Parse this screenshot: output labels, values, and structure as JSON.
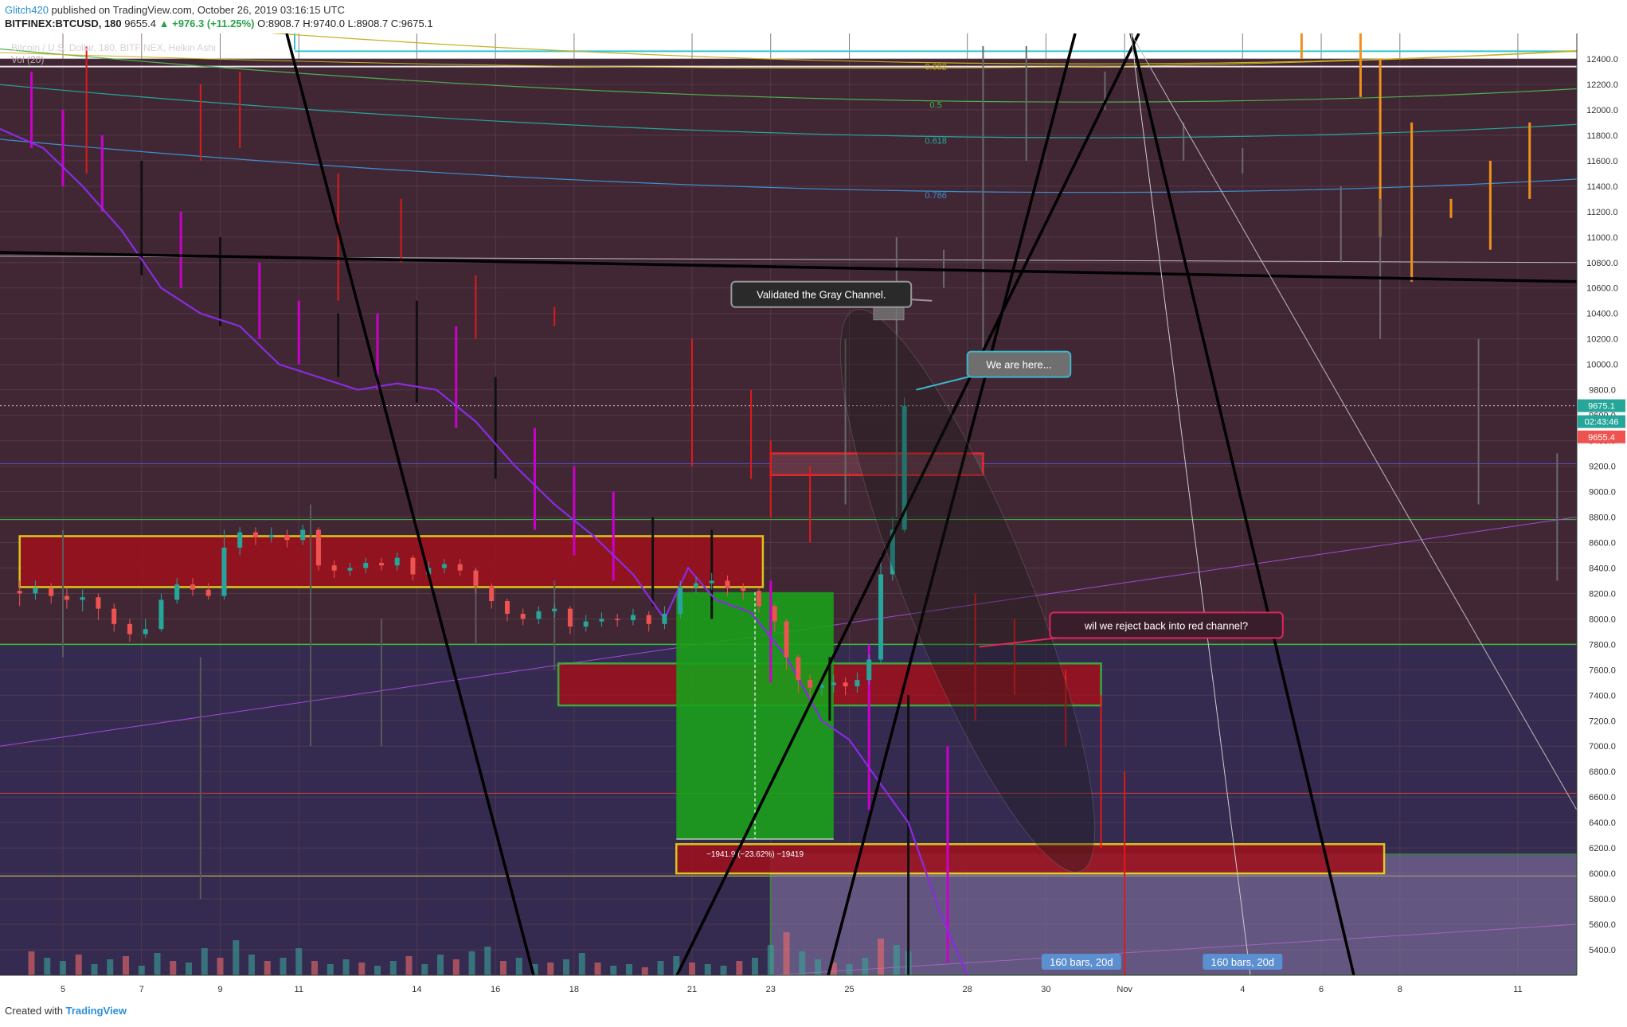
{
  "header": {
    "user": "Glitch420",
    "published_text": "published on TradingView.com, October 26, 2019 03:16:15 UTC",
    "symbol": "BITFINEX:BTCUSD, 180",
    "last": "9655.4",
    "change": "▲ +976.3 (+11.25%)",
    "ohlc": "O:8908.7 H:9740.0 L:8908.7 C:9675.1"
  },
  "legend": {
    "title": "Bitcoin / U.S. Dollar, 180, BITFINEX, Heikin Ashi",
    "volume": "Vol (20)"
  },
  "footer": {
    "created_with": "Created with",
    "brand": "TradingView"
  },
  "colors": {
    "background": "#412734",
    "panel_lower": "#352a4f",
    "bull": "#26a69a",
    "bear": "#ef5350",
    "accent_green": "#1aa01a",
    "zone_red": "#9a1723",
    "zone_border_yellow": "#f5e11a"
  },
  "chart_data": {
    "type": "candlestick",
    "ylim": [
      5200,
      12600
    ],
    "y_ticks": [
      5400,
      5600,
      5800,
      6000,
      6200,
      6400,
      6600,
      6800,
      7000,
      7200,
      7400,
      7600,
      7800,
      8000,
      8200,
      8400,
      8600,
      8800,
      9000,
      9200,
      9400,
      9600,
      9800,
      10000,
      10200,
      10400,
      10600,
      10800,
      11000,
      11200,
      11400,
      11600,
      11800,
      12000,
      12200,
      12400
    ],
    "x_ticks": [
      {
        "label": "5",
        "day": 5
      },
      {
        "label": "7",
        "day": 7
      },
      {
        "label": "9",
        "day": 9
      },
      {
        "label": "11",
        "day": 11
      },
      {
        "label": "14",
        "day": 14
      },
      {
        "label": "16",
        "day": 16
      },
      {
        "label": "18",
        "day": 18
      },
      {
        "label": "21",
        "day": 21
      },
      {
        "label": "23",
        "day": 23
      },
      {
        "label": "25",
        "day": 25
      },
      {
        "label": "28",
        "day": 28
      },
      {
        "label": "30",
        "day": 30
      },
      {
        "label": "Nov",
        "day": 32
      },
      {
        "label": "4",
        "day": 35
      },
      {
        "label": "6",
        "day": 37
      },
      {
        "label": "8",
        "day": 39
      },
      {
        "label": "11",
        "day": 42
      }
    ],
    "price_badges": [
      {
        "text": "9675.1",
        "price": 9675.1,
        "color": "#26a69a"
      },
      {
        "text": "02:43:46",
        "price": 9550,
        "color": "#26a69a"
      },
      {
        "text": "9655.4",
        "price": 9430,
        "color": "#ef5350"
      }
    ],
    "fib_levels": [
      {
        "label": "0.382",
        "price": 12340,
        "color": "#c8b020"
      },
      {
        "label": "0.5",
        "price": 12040,
        "color": "#4caf50"
      },
      {
        "label": "0.618",
        "price": 11760,
        "color": "#26a69a"
      },
      {
        "label": "0.786",
        "price": 11330,
        "color": "#3d8fd0"
      }
    ],
    "candles_fine": [
      {
        "day": 3.9,
        "o": 8220,
        "c": 8200,
        "h": 8300,
        "l": 8100
      },
      {
        "day": 4.3,
        "o": 8200,
        "c": 8240,
        "h": 8300,
        "l": 8150
      },
      {
        "day": 4.7,
        "o": 8240,
        "c": 8180,
        "h": 8280,
        "l": 8120
      },
      {
        "day": 5.1,
        "o": 8180,
        "c": 8150,
        "h": 8250,
        "l": 8080
      },
      {
        "day": 5.5,
        "o": 8150,
        "c": 8170,
        "h": 8230,
        "l": 8060
      },
      {
        "day": 5.9,
        "o": 8170,
        "c": 8080,
        "h": 8200,
        "l": 7990
      },
      {
        "day": 6.3,
        "o": 8080,
        "c": 7960,
        "h": 8120,
        "l": 7900
      },
      {
        "day": 6.7,
        "o": 7960,
        "c": 7880,
        "h": 8000,
        "l": 7820
      },
      {
        "day": 7.1,
        "o": 7880,
        "c": 7920,
        "h": 8000,
        "l": 7850
      },
      {
        "day": 7.5,
        "o": 7920,
        "c": 8150,
        "h": 8200,
        "l": 7900
      },
      {
        "day": 7.9,
        "o": 8150,
        "c": 8270,
        "h": 8320,
        "l": 8120
      },
      {
        "day": 8.3,
        "o": 8270,
        "c": 8230,
        "h": 8320,
        "l": 8180
      },
      {
        "day": 8.7,
        "o": 8230,
        "c": 8180,
        "h": 8280,
        "l": 8150
      },
      {
        "day": 9.1,
        "o": 8180,
        "c": 8560,
        "h": 8700,
        "l": 8150
      },
      {
        "day": 9.5,
        "o": 8560,
        "c": 8680,
        "h": 8720,
        "l": 8500
      },
      {
        "day": 9.9,
        "o": 8680,
        "c": 8640,
        "h": 8720,
        "l": 8580
      },
      {
        "day": 10.3,
        "o": 8640,
        "c": 8660,
        "h": 8720,
        "l": 8600
      },
      {
        "day": 10.7,
        "o": 8660,
        "c": 8620,
        "h": 8700,
        "l": 8560
      },
      {
        "day": 11.1,
        "o": 8620,
        "c": 8700,
        "h": 8740,
        "l": 8580
      },
      {
        "day": 11.5,
        "o": 8700,
        "c": 8420,
        "h": 8720,
        "l": 8380
      },
      {
        "day": 11.9,
        "o": 8420,
        "c": 8380,
        "h": 8460,
        "l": 8320
      },
      {
        "day": 12.3,
        "o": 8380,
        "c": 8400,
        "h": 8440,
        "l": 8340
      },
      {
        "day": 12.7,
        "o": 8400,
        "c": 8440,
        "h": 8480,
        "l": 8360
      },
      {
        "day": 13.1,
        "o": 8440,
        "c": 8420,
        "h": 8480,
        "l": 8380
      },
      {
        "day": 13.5,
        "o": 8420,
        "c": 8480,
        "h": 8520,
        "l": 8380
      },
      {
        "day": 13.9,
        "o": 8480,
        "c": 8350,
        "h": 8500,
        "l": 8300
      },
      {
        "day": 14.3,
        "o": 8350,
        "c": 8400,
        "h": 8450,
        "l": 8310
      },
      {
        "day": 14.7,
        "o": 8400,
        "c": 8430,
        "h": 8470,
        "l": 8360
      },
      {
        "day": 15.1,
        "o": 8430,
        "c": 8380,
        "h": 8470,
        "l": 8340
      },
      {
        "day": 15.5,
        "o": 8380,
        "c": 8260,
        "h": 8400,
        "l": 8200
      },
      {
        "day": 15.9,
        "o": 8260,
        "c": 8140,
        "h": 8280,
        "l": 8080
      },
      {
        "day": 16.3,
        "o": 8140,
        "c": 8040,
        "h": 8160,
        "l": 7980
      },
      {
        "day": 16.7,
        "o": 8040,
        "c": 8000,
        "h": 8080,
        "l": 7950
      },
      {
        "day": 17.1,
        "o": 8000,
        "c": 8060,
        "h": 8100,
        "l": 7960
      },
      {
        "day": 17.5,
        "o": 8060,
        "c": 8080,
        "h": 8120,
        "l": 8010
      },
      {
        "day": 17.9,
        "o": 8080,
        "c": 7940,
        "h": 8100,
        "l": 7880
      },
      {
        "day": 18.3,
        "o": 7940,
        "c": 7980,
        "h": 8030,
        "l": 7900
      },
      {
        "day": 18.7,
        "o": 7980,
        "c": 8000,
        "h": 8050,
        "l": 7940
      },
      {
        "day": 19.1,
        "o": 8000,
        "c": 7990,
        "h": 8040,
        "l": 7940
      },
      {
        "day": 19.5,
        "o": 7990,
        "c": 8030,
        "h": 8080,
        "l": 7950
      },
      {
        "day": 19.9,
        "o": 8030,
        "c": 7960,
        "h": 8060,
        "l": 7900
      },
      {
        "day": 20.3,
        "o": 7960,
        "c": 8040,
        "h": 8100,
        "l": 7920
      },
      {
        "day": 20.7,
        "o": 8040,
        "c": 8250,
        "h": 8300,
        "l": 8000
      },
      {
        "day": 21.1,
        "o": 8250,
        "c": 8280,
        "h": 8330,
        "l": 8200
      },
      {
        "day": 21.5,
        "o": 8280,
        "c": 8300,
        "h": 8360,
        "l": 8230
      },
      {
        "day": 21.9,
        "o": 8300,
        "c": 8240,
        "h": 8340,
        "l": 8180
      },
      {
        "day": 22.3,
        "o": 8240,
        "c": 8220,
        "h": 8280,
        "l": 8150
      },
      {
        "day": 22.7,
        "o": 8220,
        "c": 8100,
        "h": 8250,
        "l": 8050
      },
      {
        "day": 23.1,
        "o": 8100,
        "c": 7980,
        "h": 8120,
        "l": 7900
      },
      {
        "day": 23.4,
        "o": 7980,
        "c": 7700,
        "h": 8000,
        "l": 7600
      },
      {
        "day": 23.7,
        "o": 7700,
        "c": 7520,
        "h": 7720,
        "l": 7420
      },
      {
        "day": 24.0,
        "o": 7520,
        "c": 7460,
        "h": 7560,
        "l": 7380
      },
      {
        "day": 24.3,
        "o": 7460,
        "c": 7480,
        "h": 7540,
        "l": 7400
      },
      {
        "day": 24.6,
        "o": 7480,
        "c": 7500,
        "h": 7560,
        "l": 7420
      },
      {
        "day": 24.9,
        "o": 7500,
        "c": 7470,
        "h": 7540,
        "l": 7400
      },
      {
        "day": 25.2,
        "o": 7470,
        "c": 7520,
        "h": 7580,
        "l": 7420
      },
      {
        "day": 25.5,
        "o": 7520,
        "c": 7680,
        "h": 7720,
        "l": 7480
      },
      {
        "day": 25.8,
        "o": 7680,
        "c": 8350,
        "h": 8500,
        "l": 7650
      },
      {
        "day": 26.1,
        "o": 8350,
        "c": 8700,
        "h": 8800,
        "l": 8300
      },
      {
        "day": 26.4,
        "o": 8700,
        "c": 9675,
        "h": 9740,
        "l": 8680
      }
    ],
    "candles_coarse": [
      {
        "day": 4.2,
        "o": 12000,
        "c": 11900,
        "h": 12300,
        "l": 11700,
        "color": "#cc00cc"
      },
      {
        "day": 5.0,
        "o": 11900,
        "c": 11600,
        "h": 12000,
        "l": 11400,
        "color": "#cc00cc"
      },
      {
        "day": 6.0,
        "o": 11700,
        "c": 11300,
        "h": 11800,
        "l": 11200,
        "color": "#cc00cc"
      },
      {
        "day": 7.0,
        "o": 11500,
        "c": 11000,
        "h": 11600,
        "l": 10700,
        "color": "#111111"
      },
      {
        "day": 8.0,
        "o": 11100,
        "c": 10700,
        "h": 11200,
        "l": 10600,
        "color": "#cc00cc"
      },
      {
        "day": 9.0,
        "o": 10900,
        "c": 10600,
        "h": 11000,
        "l": 10300,
        "color": "#111111"
      },
      {
        "day": 10.0,
        "o": 10700,
        "c": 10300,
        "h": 10800,
        "l": 10200,
        "color": "#cc00cc"
      },
      {
        "day": 11.0,
        "o": 10400,
        "c": 10100,
        "h": 10500,
        "l": 10000,
        "color": "#cc00cc"
      },
      {
        "day": 12.0,
        "o": 10300,
        "c": 10000,
        "h": 10400,
        "l": 9900,
        "color": "#111111"
      },
      {
        "day": 13.0,
        "o": 10200,
        "c": 10100,
        "h": 10400,
        "l": 9800,
        "color": "#cc00cc"
      },
      {
        "day": 14.0,
        "o": 10300,
        "c": 9900,
        "h": 10500,
        "l": 9700,
        "color": "#111111"
      },
      {
        "day": 15.0,
        "o": 10200,
        "c": 9600,
        "h": 10300,
        "l": 9500,
        "color": "#cc00cc"
      },
      {
        "day": 16.0,
        "o": 9800,
        "c": 9300,
        "h": 9900,
        "l": 9100,
        "color": "#111111"
      },
      {
        "day": 17.0,
        "o": 9400,
        "c": 8900,
        "h": 9500,
        "l": 8700,
        "color": "#cc00cc"
      },
      {
        "day": 18.0,
        "o": 9100,
        "c": 8700,
        "h": 9200,
        "l": 8500,
        "color": "#cc00cc"
      },
      {
        "day": 19.0,
        "o": 8800,
        "c": 8500,
        "h": 9000,
        "l": 8300,
        "color": "#cc00cc"
      },
      {
        "day": 20.0,
        "o": 8600,
        "c": 8300,
        "h": 8800,
        "l": 8100,
        "color": "#111111"
      },
      {
        "day": 21.5,
        "o": 8300,
        "c": 8100,
        "h": 8700,
        "l": 8000,
        "color": "#111111"
      },
      {
        "day": 23.0,
        "o": 8200,
        "c": 7700,
        "h": 8300,
        "l": 7500,
        "color": "#cc00cc"
      },
      {
        "day": 24.5,
        "o": 7600,
        "c": 7400,
        "h": 7700,
        "l": 7200,
        "color": "#111111"
      },
      {
        "day": 25.5,
        "o": 7500,
        "c": 7000,
        "h": 7800,
        "l": 6500,
        "color": "#cc00cc"
      },
      {
        "day": 26.5,
        "o": 7100,
        "c": 6200,
        "h": 7400,
        "l": 5200,
        "color": "#111111"
      },
      {
        "day": 27.5,
        "o": 6800,
        "c": 5900,
        "h": 7000,
        "l": 5300,
        "color": "#cc00cc"
      }
    ],
    "candles_weekly_orange": [
      {
        "day": 36.5,
        "o": 12700,
        "c": 12500,
        "h": 12800,
        "l": 12400
      },
      {
        "day": 38.0,
        "o": 12500,
        "c": 12200,
        "h": 12700,
        "l": 12100
      },
      {
        "day": 38.5,
        "o": 12200,
        "c": 11100,
        "h": 12400,
        "l": 11000
      },
      {
        "day": 39.3,
        "o": 11800,
        "c": 10700,
        "h": 11900,
        "l": 10650
      },
      {
        "day": 40.3,
        "o": 11250,
        "c": 11200,
        "h": 11300,
        "l": 11150
      },
      {
        "day": 41.3,
        "o": 11000,
        "c": 11500,
        "h": 11600,
        "l": 10900
      },
      {
        "day": 42.3,
        "o": 11400,
        "c": 11850,
        "h": 11900,
        "l": 11300
      }
    ],
    "zones": [
      {
        "day_from": 3.9,
        "day_to": 22.8,
        "top": 8650,
        "bottom": 8250,
        "fill": "#a0101c",
        "border": "#f5e11a"
      },
      {
        "day_from": 17.6,
        "day_to": 31.4,
        "top": 7650,
        "bottom": 7320,
        "fill": "#a0101c",
        "border": "#3cbe3c"
      },
      {
        "day_from": 23.0,
        "day_to": 28.4,
        "top": 9300,
        "bottom": 9130,
        "fill": "#6a3a48",
        "border": "#ff2a2a"
      },
      {
        "day_from": 20.6,
        "day_to": 38.6,
        "top": 6230,
        "bottom": 6000,
        "fill": "#a0101c",
        "border": "#f5e11a"
      }
    ],
    "measure": {
      "day_from": 20.6,
      "day_to": 24.6,
      "top": 8210,
      "bottom": 6270,
      "label": "−1941.9 (−23.62%) −19419"
    },
    "annotations": [
      {
        "id": "gray",
        "text": "Validated the Gray Channel.",
        "day": 22.0,
        "price": 10650,
        "target_day": 27.1,
        "target_price": 10500,
        "fill": "#2a2a2a",
        "border": "#999999"
      },
      {
        "id": "here",
        "text": "We are here...",
        "day": 28.0,
        "price": 10100,
        "target_day": 26.7,
        "target_price": 9800,
        "fill": "#6f6f6f",
        "border": "#3bb6cc"
      },
      {
        "id": "reject",
        "text": "wil we reject back into red channel?",
        "day": 30.1,
        "price": 8050,
        "target_day": 28.3,
        "target_price": 7780,
        "fill": "#3a1d2a",
        "border": "#e0245e"
      }
    ],
    "bar_labels": [
      {
        "text": "160 bars, 20d",
        "day": 30.9
      },
      {
        "text": "160 bars, 20d",
        "day": 35.0
      }
    ],
    "volume": [
      {
        "day": 4.2,
        "v": 30
      },
      {
        "day": 4.6,
        "v": 22
      },
      {
        "day": 5.0,
        "v": 18
      },
      {
        "day": 5.4,
        "v": 26
      },
      {
        "day": 5.8,
        "v": 14
      },
      {
        "day": 6.2,
        "v": 20
      },
      {
        "day": 6.6,
        "v": 24
      },
      {
        "day": 7.0,
        "v": 12
      },
      {
        "day": 7.4,
        "v": 28
      },
      {
        "day": 7.8,
        "v": 18
      },
      {
        "day": 8.2,
        "v": 16
      },
      {
        "day": 8.6,
        "v": 34
      },
      {
        "day": 9.0,
        "v": 22
      },
      {
        "day": 9.4,
        "v": 44
      },
      {
        "day": 9.8,
        "v": 26
      },
      {
        "day": 10.2,
        "v": 18
      },
      {
        "day": 10.6,
        "v": 22
      },
      {
        "day": 11.0,
        "v": 34
      },
      {
        "day": 11.4,
        "v": 18
      },
      {
        "day": 11.8,
        "v": 14
      },
      {
        "day": 12.2,
        "v": 20
      },
      {
        "day": 12.6,
        "v": 16
      },
      {
        "day": 13.0,
        "v": 12
      },
      {
        "day": 13.4,
        "v": 18
      },
      {
        "day": 13.8,
        "v": 24
      },
      {
        "day": 14.2,
        "v": 14
      },
      {
        "day": 14.6,
        "v": 26
      },
      {
        "day": 15.0,
        "v": 20
      },
      {
        "day": 15.4,
        "v": 30
      },
      {
        "day": 15.8,
        "v": 36
      },
      {
        "day": 16.2,
        "v": 18
      },
      {
        "day": 16.6,
        "v": 22
      },
      {
        "day": 17.0,
        "v": 14
      },
      {
        "day": 17.4,
        "v": 16
      },
      {
        "day": 17.8,
        "v": 20
      },
      {
        "day": 18.2,
        "v": 28
      },
      {
        "day": 18.6,
        "v": 16
      },
      {
        "day": 19.0,
        "v": 12
      },
      {
        "day": 19.4,
        "v": 14
      },
      {
        "day": 19.8,
        "v": 10
      },
      {
        "day": 20.2,
        "v": 18
      },
      {
        "day": 20.6,
        "v": 24
      },
      {
        "day": 21.0,
        "v": 16
      },
      {
        "day": 21.4,
        "v": 14
      },
      {
        "day": 21.8,
        "v": 12
      },
      {
        "day": 22.2,
        "v": 18
      },
      {
        "day": 22.6,
        "v": 22
      },
      {
        "day": 23.0,
        "v": 38
      },
      {
        "day": 23.4,
        "v": 54
      },
      {
        "day": 23.8,
        "v": 30
      },
      {
        "day": 24.2,
        "v": 20
      },
      {
        "day": 24.6,
        "v": 16
      },
      {
        "day": 25.0,
        "v": 14
      },
      {
        "day": 25.4,
        "v": 22
      },
      {
        "day": 25.8,
        "v": 46
      },
      {
        "day": 26.2,
        "v": 38
      },
      {
        "day": 26.5,
        "v": 30
      }
    ]
  }
}
